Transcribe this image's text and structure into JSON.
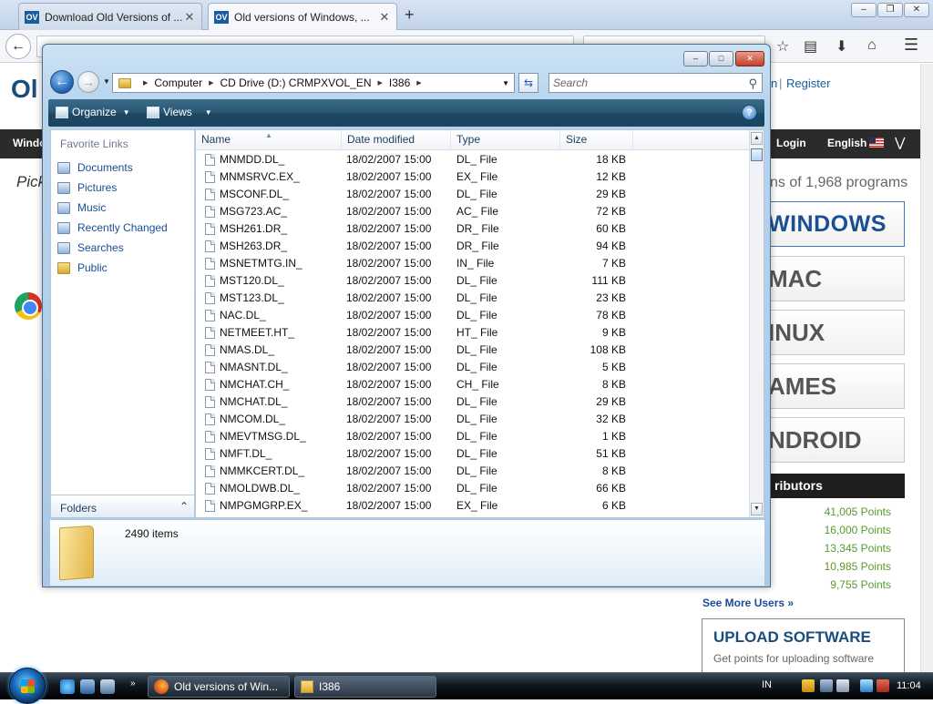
{
  "browser": {
    "tabs": [
      {
        "label": "Download Old Versions of ...",
        "close": "✕"
      },
      {
        "label": "Old versions of Windows, ...",
        "close": "✕"
      }
    ],
    "newtab": "+",
    "window_controls": {
      "minimize": "‒",
      "maximize": "❐",
      "close": "✕"
    }
  },
  "site": {
    "logo": "Ol",
    "register": "Register",
    "in_fragment": "n",
    "nav_left": "Windo",
    "login": "Login",
    "language": "English",
    "pick": "Pick",
    "programs_count": "ns of 1,968 programs",
    "platforms": [
      "WINDOWS",
      "MAC",
      "INUX",
      "AMES",
      "NDROID"
    ],
    "contributors_title": "ributors",
    "points": [
      "41,005 Points",
      "16,000 Points",
      "13,345 Points",
      "10,985 Points",
      "9,755 Points"
    ],
    "see_more": "See More Users »",
    "upload_title": "UPLOAD SOFTWARE",
    "upload_desc": "Get points for uploading software"
  },
  "explorer": {
    "breadcrumb": [
      "Computer",
      "CD Drive (D:) CRMPXVOL_EN",
      "I386"
    ],
    "search_placeholder": "Search",
    "toolbar": {
      "organize": "Organize",
      "views": "Views",
      "help": "?"
    },
    "favorites_header": "Favorite Links",
    "favorites": [
      "Documents",
      "Pictures",
      "Music",
      "Recently Changed",
      "Searches",
      "Public"
    ],
    "folders_label": "Folders",
    "columns": [
      "Name",
      "Date modified",
      "Type",
      "Size"
    ],
    "files": [
      {
        "name": "MNMDD.DL_",
        "date": "18/02/2007 15:00",
        "type": "DL_ File",
        "size": "18 KB"
      },
      {
        "name": "MNMSRVC.EX_",
        "date": "18/02/2007 15:00",
        "type": "EX_ File",
        "size": "12 KB"
      },
      {
        "name": "MSCONF.DL_",
        "date": "18/02/2007 15:00",
        "type": "DL_ File",
        "size": "29 KB"
      },
      {
        "name": "MSG723.AC_",
        "date": "18/02/2007 15:00",
        "type": "AC_ File",
        "size": "72 KB"
      },
      {
        "name": "MSH261.DR_",
        "date": "18/02/2007 15:00",
        "type": "DR_ File",
        "size": "60 KB"
      },
      {
        "name": "MSH263.DR_",
        "date": "18/02/2007 15:00",
        "type": "DR_ File",
        "size": "94 KB"
      },
      {
        "name": "MSNETMTG.IN_",
        "date": "18/02/2007 15:00",
        "type": "IN_ File",
        "size": "7 KB"
      },
      {
        "name": "MST120.DL_",
        "date": "18/02/2007 15:00",
        "type": "DL_ File",
        "size": "111 KB"
      },
      {
        "name": "MST123.DL_",
        "date": "18/02/2007 15:00",
        "type": "DL_ File",
        "size": "23 KB"
      },
      {
        "name": "NAC.DL_",
        "date": "18/02/2007 15:00",
        "type": "DL_ File",
        "size": "78 KB"
      },
      {
        "name": "NETMEET.HT_",
        "date": "18/02/2007 15:00",
        "type": "HT_ File",
        "size": "9 KB"
      },
      {
        "name": "NMAS.DL_",
        "date": "18/02/2007 15:00",
        "type": "DL_ File",
        "size": "108 KB"
      },
      {
        "name": "NMASNT.DL_",
        "date": "18/02/2007 15:00",
        "type": "DL_ File",
        "size": "5 KB"
      },
      {
        "name": "NMCHAT.CH_",
        "date": "18/02/2007 15:00",
        "type": "CH_ File",
        "size": "8 KB"
      },
      {
        "name": "NMCHAT.DL_",
        "date": "18/02/2007 15:00",
        "type": "DL_ File",
        "size": "29 KB"
      },
      {
        "name": "NMCOM.DL_",
        "date": "18/02/2007 15:00",
        "type": "DL_ File",
        "size": "32 KB"
      },
      {
        "name": "NMEVTMSG.DL_",
        "date": "18/02/2007 15:00",
        "type": "DL_ File",
        "size": "1 KB"
      },
      {
        "name": "NMFT.DL_",
        "date": "18/02/2007 15:00",
        "type": "DL_ File",
        "size": "51 KB"
      },
      {
        "name": "NMMKCERT.DL_",
        "date": "18/02/2007 15:00",
        "type": "DL_ File",
        "size": "8 KB"
      },
      {
        "name": "NMOLDWB.DL_",
        "date": "18/02/2007 15:00",
        "type": "DL_ File",
        "size": "66 KB"
      },
      {
        "name": "NMPGMGRP.EX_",
        "date": "18/02/2007 15:00",
        "type": "EX_ File",
        "size": "6 KB"
      }
    ],
    "item_count": "2490 items"
  },
  "taskbar": {
    "tasks": [
      "Old versions of Win...",
      "I386"
    ],
    "language": "IN",
    "clock": "11:04"
  },
  "colors": {
    "accent": "#1a4d96",
    "points_green": "#5a9a2a",
    "toolbar": "#285673"
  }
}
